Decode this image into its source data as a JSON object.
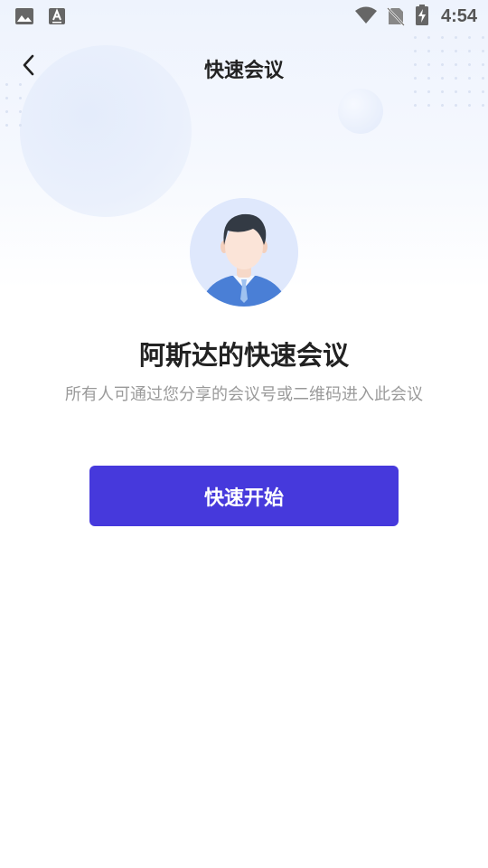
{
  "status_bar": {
    "time": "4:54",
    "left_icons": [
      "image-icon",
      "keyboard-a-icon"
    ],
    "right_icons": [
      "wifi-icon",
      "no-sim-icon",
      "battery-charging-icon"
    ]
  },
  "header": {
    "title": "快速会议",
    "back_icon": "chevron-left-icon"
  },
  "profile": {
    "avatar_icon": "user-avatar-icon",
    "meeting_name": "阿斯达的快速会议",
    "description": "所有人可通过您分享的会议号或二维码进入此会议"
  },
  "actions": {
    "start_label": "快速开始"
  },
  "colors": {
    "primary": "#4639dc",
    "title_text": "#222222",
    "secondary_text": "#9a9a9a",
    "hero_bg": "#eef3fd"
  }
}
